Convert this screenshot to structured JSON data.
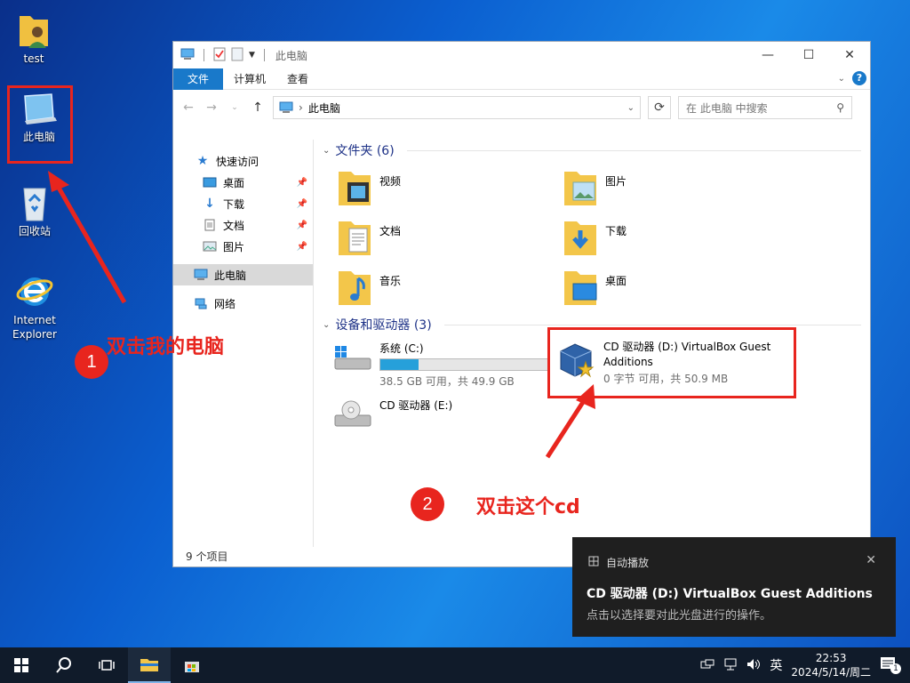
{
  "desktop": {
    "icons": [
      {
        "label": "test"
      },
      {
        "label": "此电脑"
      },
      {
        "label": "回收站"
      },
      {
        "label": "Internet Explorer"
      }
    ]
  },
  "annotations": {
    "step1_num": "1",
    "step1_text": "双击我的电脑",
    "step2_num": "2",
    "step2_text": "双击这个cd",
    "color": "#e8251e"
  },
  "window": {
    "title": "此电脑",
    "ribbon_tabs": [
      "文件",
      "计算机",
      "查看"
    ],
    "address": "此电脑",
    "search_placeholder": "在 此电脑 中搜索",
    "nav": {
      "quick_access": "快速访问",
      "items": [
        "桌面",
        "下载",
        "文档",
        "图片"
      ],
      "this_pc": "此电脑",
      "network": "网络"
    },
    "folders_header": "文件夹 (6)",
    "folders": [
      "视频",
      "图片",
      "文档",
      "下载",
      "音乐",
      "桌面"
    ],
    "devices_header": "设备和驱动器 (3)",
    "drives": {
      "c_name": "系统 (C:)",
      "c_space": "38.5 GB 可用，共 49.9 GB",
      "c_used_fraction": 0.23,
      "d_name_line1": "CD 驱动器 (D:) VirtualBox Guest",
      "d_name_line2": "Additions",
      "d_space": "0 字节 可用，共 50.9 MB",
      "e_name": "CD 驱动器 (E:)"
    },
    "status": "9 个项目"
  },
  "toast": {
    "app": "自动播放",
    "title": "CD 驱动器 (D:) VirtualBox Guest Additions",
    "body": "点击以选择要对此光盘进行的操作。"
  },
  "taskbar": {
    "ime": "英",
    "time": "22:53",
    "date": "2024/5/14/周二",
    "notification_count": "1"
  }
}
